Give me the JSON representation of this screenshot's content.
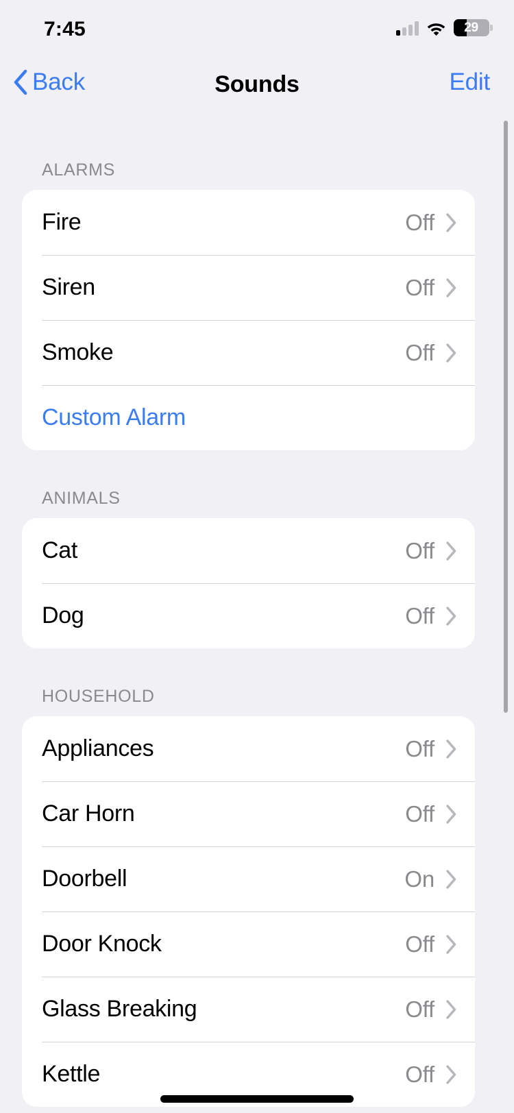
{
  "status_bar": {
    "time": "7:45",
    "cellular_icon": "cellular-signal-icon",
    "wifi_icon": "wifi-icon",
    "battery_icon": "battery-icon",
    "battery_percent": "29"
  },
  "nav_bar": {
    "back_label": "Back",
    "back_icon": "chevron-left-icon",
    "title": "Sounds",
    "edit_label": "Edit"
  },
  "colors": {
    "accent_blue": "#3C7CF3",
    "page_background": "#F1F1F5",
    "card_background": "#FFFFFF",
    "secondary_text": "#8A8A8E",
    "separator": "#D2D2D4"
  },
  "sections": [
    {
      "header": "ALARMS",
      "rows": [
        {
          "label": "Fire",
          "value": "Off",
          "chevron": "chevron-right-icon",
          "style": "value"
        },
        {
          "label": "Siren",
          "value": "Off",
          "chevron": "chevron-right-icon",
          "style": "value"
        },
        {
          "label": "Smoke",
          "value": "Off",
          "chevron": "chevron-right-icon",
          "style": "value"
        },
        {
          "label": "Custom Alarm",
          "value": "",
          "chevron": "",
          "style": "link"
        }
      ]
    },
    {
      "header": "ANIMALS",
      "rows": [
        {
          "label": "Cat",
          "value": "Off",
          "chevron": "chevron-right-icon",
          "style": "value"
        },
        {
          "label": "Dog",
          "value": "Off",
          "chevron": "chevron-right-icon",
          "style": "value"
        }
      ]
    },
    {
      "header": "HOUSEHOLD",
      "rows": [
        {
          "label": "Appliances",
          "value": "Off",
          "chevron": "chevron-right-icon",
          "style": "value"
        },
        {
          "label": "Car Horn",
          "value": "Off",
          "chevron": "chevron-right-icon",
          "style": "value"
        },
        {
          "label": "Doorbell",
          "value": "On",
          "chevron": "chevron-right-icon",
          "style": "value"
        },
        {
          "label": "Door Knock",
          "value": "Off",
          "chevron": "chevron-right-icon",
          "style": "value"
        },
        {
          "label": "Glass Breaking",
          "value": "Off",
          "chevron": "chevron-right-icon",
          "style": "value"
        },
        {
          "label": "Kettle",
          "value": "Off",
          "chevron": "chevron-right-icon",
          "style": "value"
        }
      ]
    }
  ],
  "scroll_indicator": "vertical-scrollbar",
  "home_indicator": "home-indicator-bar"
}
